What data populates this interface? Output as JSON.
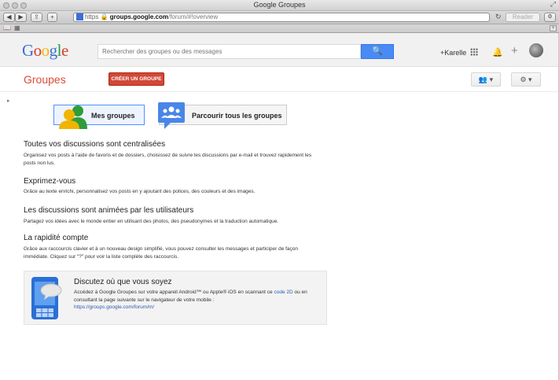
{
  "browser": {
    "window_title": "Google Groupes",
    "url_scheme": "https",
    "url_host": "groups.google.com",
    "url_path": "/forum/#!overview",
    "reader_label": "Reader"
  },
  "gbar": {
    "logo_text": "Google",
    "search_placeholder": "Rechercher des groupes ou des messages",
    "user_name": "+Karelle"
  },
  "header": {
    "title": "Groupes",
    "create_label": "CRÉER UN GROUPE"
  },
  "tiles": {
    "my_groups": "Mes groupes",
    "browse": "Parcourir tous les groupes"
  },
  "sections": [
    {
      "title": "Toutes vos discussions sont centralisées",
      "text": "Organisez vos posts à l'aide de favoris et de dossiers, choisissez de suivre les discussions par e-mail et trouvez rapidement les posts non lus."
    },
    {
      "title": "Exprimez-vous",
      "text": "Grâce au texte enrichi, personnalisez vos posts en y ajoutant des polices, des couleurs et des images."
    },
    {
      "title": "Les discussions sont animées par les utilisateurs",
      "text": "Partagez vos idées avec le monde entier en utilisant des photos, des pseudonymes et la traduction automatique."
    },
    {
      "title": "La rapidité compte",
      "text": "Grâce aux raccourcis clavier et à un nouveau design simplifié, vous pouvez consulter les messages et participer de façon immédiate. Cliquez sur \"?\" pour voir la liste complète des raccourcis."
    }
  ],
  "promo": {
    "title": "Discutez où que vous soyez",
    "text_before": "Accédez à Google Groupes sur votre appareil Android™ ou Apple® iOS en scannant ce ",
    "qr_link": "code 2D",
    "text_after": " ou en consultant la page suivante sur le navigateur de votre mobile :",
    "mobile_url": "https://groups.google.com/forum/m/"
  }
}
